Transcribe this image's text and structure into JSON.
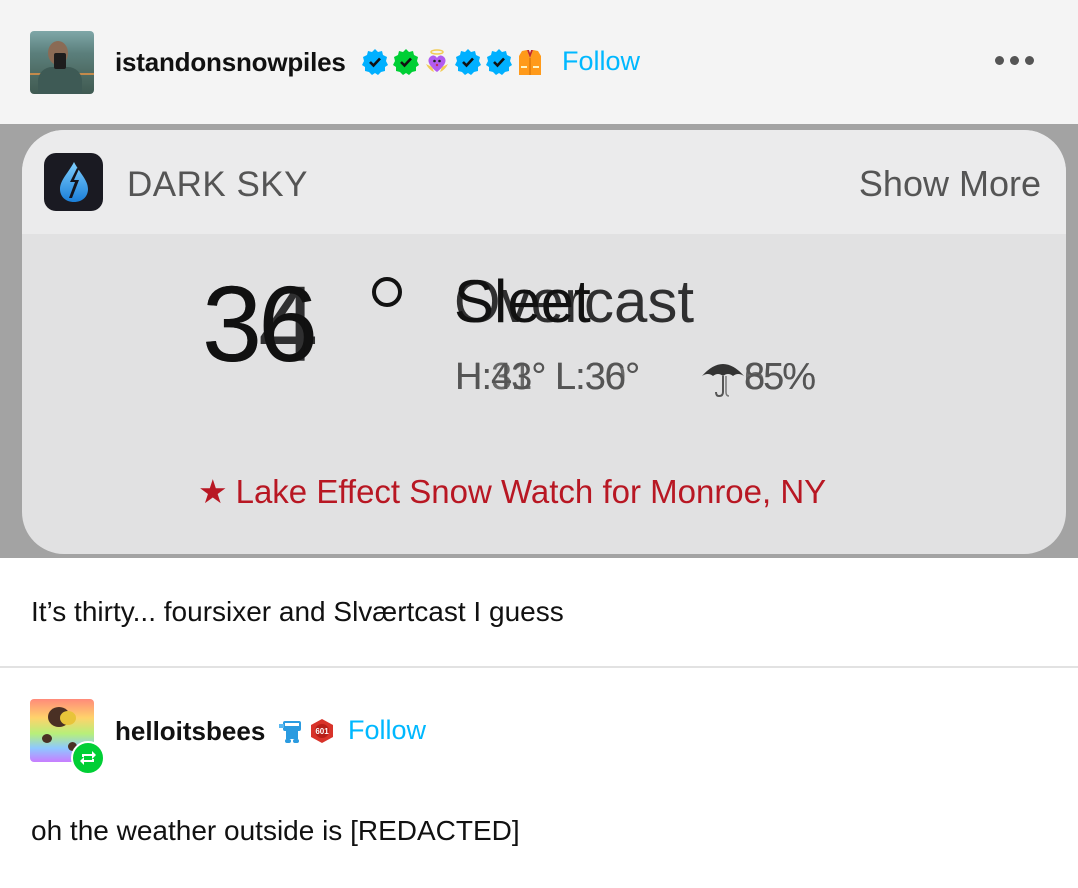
{
  "post": {
    "author": {
      "username": "istandonsnowpiles",
      "follow_label": "Follow",
      "badges": [
        "verified-blue-badge",
        "verified-green-badge",
        "angel-heart-badge",
        "verified-blue-badge",
        "verified-blue-badge",
        "orange-vest-badge"
      ]
    },
    "more_menu_icon": "ellipsis-icon",
    "widget": {
      "app_name": "DARK SKY",
      "app_icon": "raindrop-lightning-icon",
      "show_more_label": "Show More",
      "temperature_layers": [
        "36",
        "34"
      ],
      "degree_symbol": "°",
      "condition_layers": [
        "Sleet",
        "Overcast"
      ],
      "hilo_layers": [
        "H:43° L:36°",
        "H:31° L:30°"
      ],
      "precip_icon": "umbrella-icon",
      "precip_layers": [
        "85%",
        "65%"
      ],
      "alert_star": "★",
      "alert_text": "Lake Effect Snow Watch for Monroe, NY",
      "alert_color": "#b81723"
    },
    "caption": "It’s thirty... foursixer and Slværtcast I guess"
  },
  "reblog": {
    "author": {
      "username": "helloitsbees",
      "follow_label": "Follow",
      "badges": [
        "blue-robot-badge",
        "red-hexagon-601-badge"
      ],
      "hexagon_badge_text": "601"
    },
    "reblog_icon": "reblog-icon",
    "text": "oh the weather outside is [REDACTED]"
  },
  "colors": {
    "follow": "#00b8ff",
    "verified_blue": "#00b0ff",
    "verified_green": "#00cf35"
  }
}
